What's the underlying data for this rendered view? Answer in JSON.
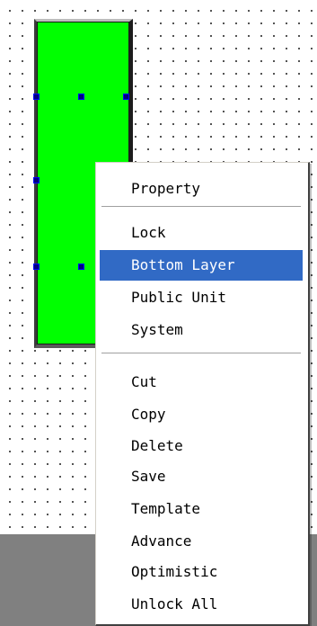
{
  "colors": {
    "widget_fill": "#00ff00",
    "selection_highlight": "#316ac5",
    "bottom_area": "#808080",
    "handle": "#000080"
  },
  "context_menu": {
    "items": [
      {
        "label": "Property"
      },
      {
        "label": "Lock"
      },
      {
        "label": "Bottom Layer",
        "selected": true
      },
      {
        "label": "Public Unit"
      },
      {
        "label": "System"
      },
      {
        "label": "Cut"
      },
      {
        "label": "Copy"
      },
      {
        "label": "Delete"
      },
      {
        "label": "Save"
      },
      {
        "label": "Template"
      },
      {
        "label": "Advance"
      },
      {
        "label": "Optimistic"
      },
      {
        "label": "Unlock All"
      }
    ]
  }
}
